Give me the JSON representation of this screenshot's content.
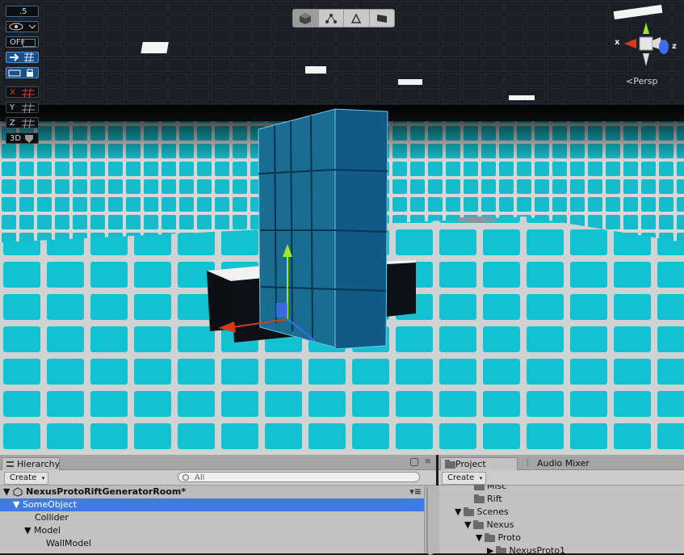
{
  "viewport": {
    "grid_snap_value": ".5",
    "visibility_label": "",
    "toggle_off_label": "OFF",
    "axes": [
      "X",
      "Y",
      "Z"
    ],
    "mode_3d_label": "3D",
    "projection_label": "<Persp",
    "gizmo_axes": {
      "x": "x",
      "z": "z"
    },
    "tools": [
      "shaded-cube-icon",
      "vertex-icon",
      "edge-icon",
      "face-icon"
    ],
    "colors": {
      "tile": "#12c4d4",
      "ceiling": "#0b0d10",
      "x_axis": "#d63a1a",
      "y_axis": "#9be82c",
      "z_axis": "#3c6df0",
      "selection": "#3e7ce2"
    }
  },
  "hierarchy": {
    "tab_label": "Hierarchy",
    "create_label": "Create",
    "search_placeholder": "All",
    "scene_name": "NexusProtoRiftGeneratorRoom*",
    "items": [
      {
        "label": "SomeObject",
        "depth": 1,
        "expanded": true,
        "selected": true
      },
      {
        "label": "Collider",
        "depth": 2
      },
      {
        "label": "Model",
        "depth": 2,
        "expanded": true
      },
      {
        "label": "WallModel",
        "depth": 3
      }
    ]
  },
  "project": {
    "tab_label": "Project",
    "mixer_tab_label": "Audio Mixer",
    "create_label": "Create",
    "items": [
      {
        "label": "Misc",
        "depth": 1
      },
      {
        "label": "Rift",
        "depth": 1
      },
      {
        "label": "Scenes",
        "depth": 0,
        "expanded": true
      },
      {
        "label": "Nexus",
        "depth": 1,
        "expanded": true
      },
      {
        "label": "Proto",
        "depth": 2,
        "expanded": true
      },
      {
        "label": "NexusProto1",
        "depth": 3
      }
    ]
  }
}
